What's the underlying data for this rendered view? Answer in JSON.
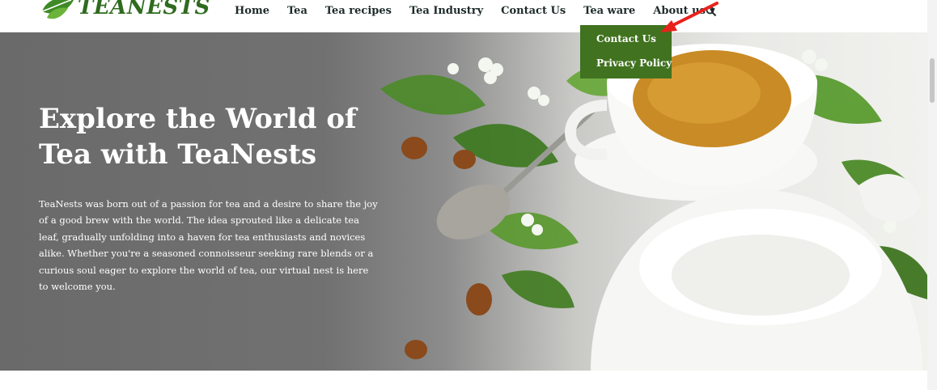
{
  "header": {
    "logo_text": "TEANESTS",
    "nav": {
      "home": "Home",
      "tea": "Tea",
      "tea_recipes": "Tea recipes",
      "tea_industry": "Tea Industry",
      "contact_us": "Contact Us",
      "tea_ware": "Tea ware",
      "about_us": "About us"
    },
    "dropdown": [
      "Contact Us",
      "Privacy Policy"
    ]
  },
  "hero": {
    "title_line1": "Explore the World of",
    "title_line2": "Tea with TeaNests",
    "description": "TeaNests was born out of a passion for tea and a desire to share the joy of a good brew with the world. The idea sprouted like a delicate tea leaf, gradually unfolding into a haven for tea enthusiasts and novices alike. Whether you're a seasoned connoisseur seeking rare blends or a curious soul eager to explore the world of tea, our virtual nest is here to welcome you."
  },
  "colors": {
    "brand_green": "#2f6b1f",
    "dropdown_bg": "#40721f",
    "annotation_arrow": "#e8221b",
    "nav_text": "#1e2a2a"
  },
  "icons": [
    "tea-leaf-logo-icon",
    "chevron-down-icon",
    "search-icon",
    "red-arrow-annotation-icon"
  ]
}
